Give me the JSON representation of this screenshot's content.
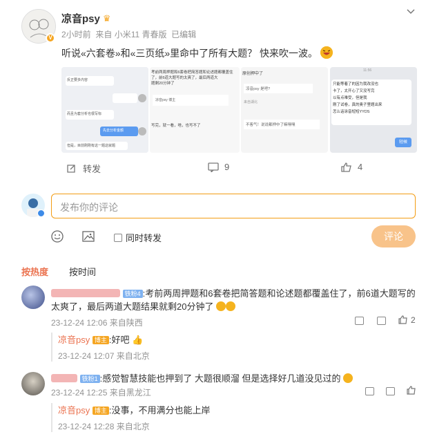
{
  "post": {
    "author": "凉音psy",
    "time": "2小时前",
    "source": "来自 小米11 青春版",
    "edited": "已编辑",
    "text": "听说«六套卷»和«三页纸»里命中了所有大题？ 快来吹一波。",
    "actions": {
      "repost": "转发",
      "comments": "9",
      "likes": "4"
    }
  },
  "compose": {
    "placeholder": "发布你的评论",
    "same_time_repost": "同时转发",
    "submit": "评论"
  },
  "tabs": {
    "hot": "按热度",
    "time": "按时间"
  },
  "comments": [
    {
      "tag": "铁粉4",
      "text": ":考前两周押题和6套卷把简答题和论述题都覆盖住了，前6道大题写的",
      "text2": "太爽了，最后两道大题结果就剩20分钟了",
      "meta": "23-12-24 12:06 来自陕西",
      "likes": "2",
      "reply": {
        "author": "凉音psy",
        "tag": "博主",
        "text": ":好吧",
        "meta": "23-12-24 12:07 来自北京"
      }
    },
    {
      "tag": "铁粉1",
      "text": ":感觉智慧技能也押到了 大题很顺溜 但是选择好几道没见过的",
      "meta": "23-12-24 12:25 来自黑龙江",
      "reply": {
        "author": "凉音psy",
        "tag": "博主",
        "text": ":没事，不用满分也能上岸",
        "meta": "23-12-24 12:28 来自北京"
      }
    }
  ],
  "thumbs": [
    {
      "lines": [
        "反正要多内容",
        "而且为套分析也很写标",
        "先去分析金额",
        "但是，目前刚刚有这一题这就题"
      ]
    },
    {
      "lines": [
        "考前两周押题和6套卷把简答题和论述题都覆盖住",
        "了，前6道大题写的太爽了，最后两道大",
        "题剩20分钟了",
        "凉音psy 博主",
        "写完，就一看，啥，也写不了"
      ]
    },
    {
      "lines": [
        "原创押中了",
        "凉音psy 是吧?",
        "来自湖北",
        "不客气！说说都押中了嘛嘿嘿"
      ]
    },
    {
      "time": "11:56",
      "lines": [
        "只能等着了的因为我改没也",
        "卡了，太开心了又没写完",
        "以有点难受，但是我",
        "刚了试卷，真的奥子里题出来",
        "怎么话涂音短短YYDS"
      ],
      "button": "轻候"
    }
  ]
}
